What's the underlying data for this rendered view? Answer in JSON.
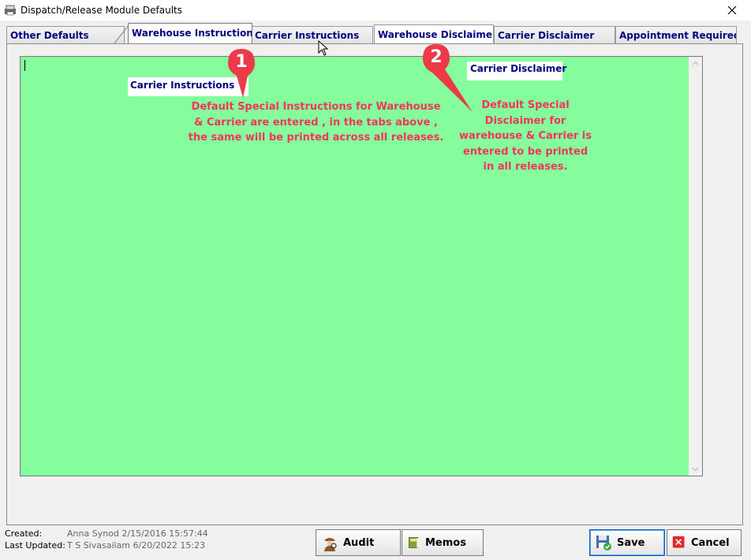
{
  "window": {
    "title": "Dispatch/Release Module Defaults"
  },
  "icons": {
    "app": "printer-icon",
    "close": "close-icon",
    "audit": "inspector-icon",
    "memos": "book-icon",
    "save": "floppy-save-icon",
    "cancel": "cancel-x-icon"
  },
  "tabs": [
    {
      "label": "Other Defaults",
      "active": false
    },
    {
      "label": "Warehouse Instructions",
      "active": true
    },
    {
      "label": "Carrier Instructions",
      "active": false
    },
    {
      "label": "Warehouse Disclaimer",
      "active": false
    },
    {
      "label": "Carrier Disclaimer",
      "active": false
    },
    {
      "label": "Appointment Required",
      "active": false
    }
  ],
  "editor": {
    "value": "",
    "background_color": "#86fd9c"
  },
  "annotations": {
    "marker_1": "1",
    "marker_2": "2",
    "label_1": "Carrier Instructions",
    "label_2": "Carrier Disclaimer",
    "note_1_lines": [
      "Default Special Instructions for Warehouse",
      "& Carrier are entered , in the tabs above ,",
      "the same will be printed across all releases."
    ],
    "note_2_lines": [
      "Default Special",
      "Disclaimer for",
      "warehouse & Carrier is",
      "entered to be printed",
      "in all releases."
    ],
    "color": "#f0365c"
  },
  "footer": {
    "created_label": "Created:",
    "created_value": "Anna Synod 2/15/2016 15:57:44",
    "updated_label": "Last Updated:",
    "updated_value": "T S Sivasailam 6/20/2022 15:23"
  },
  "buttons": {
    "audit": "Audit",
    "memos": "Memos",
    "save": "Save",
    "cancel": "Cancel"
  },
  "colors": {
    "tab_text": "#000080",
    "accent_focus": "#1060c0"
  }
}
